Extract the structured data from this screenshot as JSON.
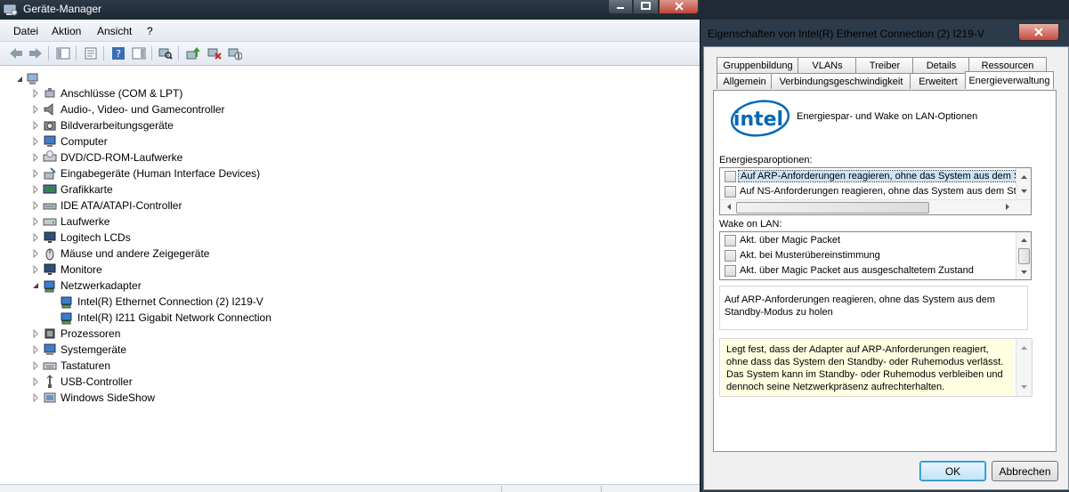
{
  "device_manager": {
    "title": "Geräte-Manager",
    "menu": [
      "Datei",
      "Aktion",
      "Ansicht",
      "?"
    ],
    "tree": [
      {
        "label": "Anschlüsse (COM & LPT)",
        "icon": "port-icon"
      },
      {
        "label": "Audio-, Video- und Gamecontroller",
        "icon": "speaker-icon"
      },
      {
        "label": "Bildverarbeitungsgeräte",
        "icon": "camera-icon"
      },
      {
        "label": "Computer",
        "icon": "computer-icon"
      },
      {
        "label": "DVD/CD-ROM-Laufwerke",
        "icon": "disc-drive-icon"
      },
      {
        "label": "Eingabegeräte (Human Interface Devices)",
        "icon": "hid-icon"
      },
      {
        "label": "Grafikkarte",
        "icon": "display-adapter-icon"
      },
      {
        "label": "IDE ATA/ATAPI-Controller",
        "icon": "ide-controller-icon"
      },
      {
        "label": "Laufwerke",
        "icon": "drive-icon"
      },
      {
        "label": "Logitech LCDs",
        "icon": "monitor-icon"
      },
      {
        "label": "Mäuse und andere Zeigegeräte",
        "icon": "mouse-icon"
      },
      {
        "label": "Monitore",
        "icon": "monitor-icon"
      },
      {
        "label": "Netzwerkadapter",
        "icon": "network-adapter-icon",
        "expanded": true,
        "children": [
          {
            "label": "Intel(R) Ethernet Connection (2) I219-V",
            "icon": "network-adapter-icon"
          },
          {
            "label": "Intel(R) I211 Gigabit Network Connection",
            "icon": "network-adapter-icon"
          }
        ]
      },
      {
        "label": "Prozessoren",
        "icon": "processor-icon"
      },
      {
        "label": "Systemgeräte",
        "icon": "system-device-icon"
      },
      {
        "label": "Tastaturen",
        "icon": "keyboard-icon"
      },
      {
        "label": "USB-Controller",
        "icon": "usb-icon"
      },
      {
        "label": "Windows SideShow",
        "icon": "sideshow-icon"
      }
    ]
  },
  "dialog": {
    "title": "Eigenschaften von Intel(R) Ethernet Connection (2) I219-V",
    "tabs_top": [
      "Gruppenbildung",
      "VLANs",
      "Treiber",
      "Details",
      "Ressourcen"
    ],
    "tabs_bottom": [
      "Allgemein",
      "Verbindungsgeschwindigkeit",
      "Erweitert",
      "Energieverwaltung"
    ],
    "active_tab": "Energieverwaltung",
    "header": "Energiespar- und Wake on LAN-Optionen",
    "power_label": "Energiesparoptionen:",
    "power_options": [
      {
        "label": "Auf ARP-Anforderungen reagieren, ohne das System aus dem S",
        "checked": false,
        "selected": true
      },
      {
        "label": "Auf NS-Anforderungen reagieren, ohne das System aus dem Sta",
        "checked": false,
        "selected": false
      }
    ],
    "wol_label": "Wake on LAN:",
    "wol_options": [
      {
        "label": "Akt. über Magic Packet",
        "checked": false
      },
      {
        "label": "Akt. bei Musterübereinstimmung",
        "checked": false
      },
      {
        "label": "Akt. über Magic Packet aus ausgeschaltetem Zustand",
        "checked": false
      }
    ],
    "description": "Auf ARP-Anforderungen reagieren, ohne das System aus dem Standby-Modus zu holen",
    "help_text": "Legt fest, dass der Adapter auf ARP-Anforderungen reagiert, ohne dass das System den Standby- oder Ruhemodus verlässt. Das System kann im Standby- oder Ruhemodus verbleiben und dennoch seine Netzwerkpräsenz aufrechterhalten.",
    "ok_label": "OK",
    "cancel_label": "Abbrechen"
  },
  "colors": {
    "selection": "#cce4f7",
    "help_background": "#ffffe1",
    "window_frame": "#2b3b4a"
  }
}
